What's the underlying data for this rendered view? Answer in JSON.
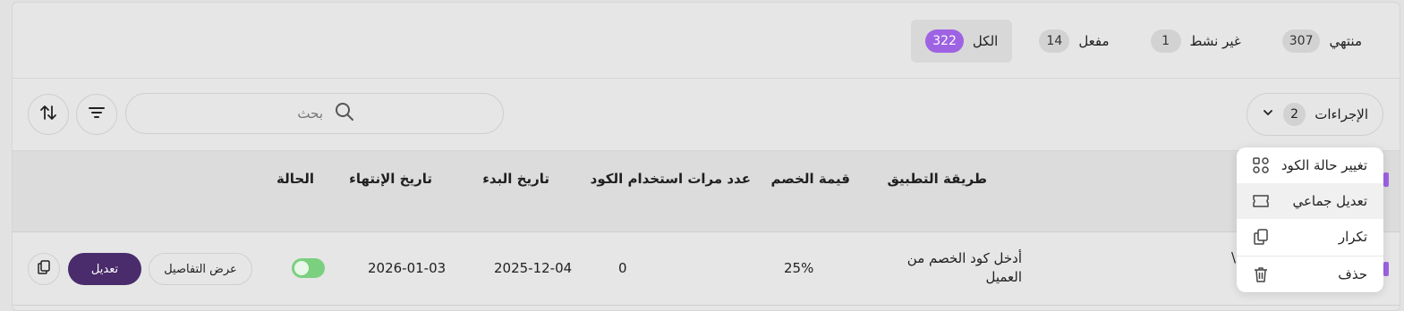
{
  "tabs": [
    {
      "label": "الكل",
      "count": "322",
      "active": true
    },
    {
      "label": "مفعل",
      "count": "14"
    },
    {
      "label": "غير نشط",
      "count": "1"
    },
    {
      "label": "منتهي",
      "count": "307"
    }
  ],
  "toolbar": {
    "actions_label": "الإجراءات",
    "actions_count": "2",
    "search_placeholder": "بحث"
  },
  "table": {
    "headers": {
      "method": "طريقة التطبيق",
      "discount": "قيمة الخصم",
      "usage": "عدد مرات استخدام الكود",
      "start": "تاريخ البدء",
      "end": "تاريخ الإنتهاء",
      "status": "الحالة"
    },
    "row": {
      "partial": "\\",
      "method_line1": "أدخل كود الخصم من",
      "method_line2": "العميل",
      "discount": "25%",
      "usage": "0",
      "start": "2025-12-04",
      "end": "2026-01-03",
      "status_on": true,
      "details_btn": "عرض التفاصيل",
      "edit_btn": "تعديل"
    }
  },
  "menu": {
    "items": [
      {
        "label": "تغيير حالة الكود",
        "icon": "status-shapes-icon"
      },
      {
        "label": "تعديل جماعي",
        "icon": "ticket-icon"
      },
      {
        "label": "تكرار",
        "icon": "copy-icon"
      },
      {
        "label": "حذف",
        "icon": "trash-icon"
      }
    ]
  },
  "colors": {
    "accent": "#9e63e3",
    "primary": "#4a2b6b",
    "toggle_on": "#7ad07f"
  }
}
